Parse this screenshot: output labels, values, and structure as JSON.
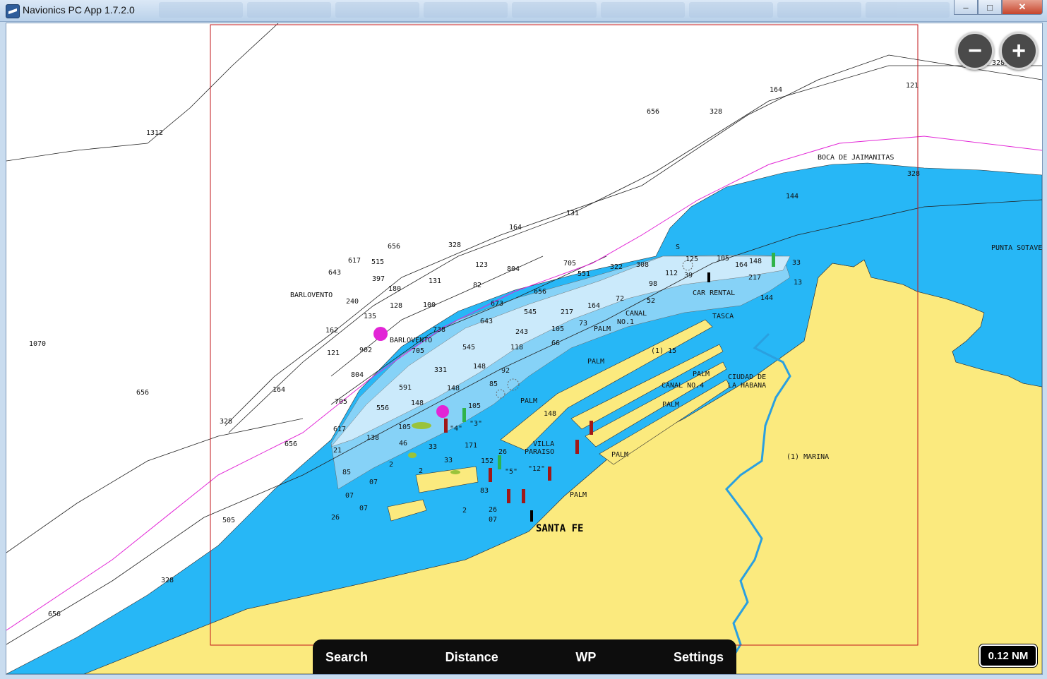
{
  "window": {
    "title": "Navionics PC App 1.7.2.0",
    "minimize": "–",
    "maximize": "□",
    "close": "✕"
  },
  "zoom": {
    "out": "−",
    "in": "+"
  },
  "toolbar": {
    "search": "Search",
    "distance": "Distance",
    "wp": "WP",
    "settings": "Settings"
  },
  "scale_label": "0.12 NM",
  "places": {
    "barlovento1": "BARLOVENTO",
    "barlovento2": "BARLOVENTO",
    "boca": "BOCA DE JAIMANITAS",
    "punta": "PUNTA SOTAVE",
    "car_rental": "CAR RENTAL",
    "tasca": "TASCA",
    "canal1a": "CANAL",
    "canal1b": "NO.1",
    "canal4": "CANAL NO.4",
    "ciudad1": "CIUDAD DE",
    "ciudad2": "LA HABANA",
    "villa1": "VILLA",
    "villa2": "PARAISO",
    "marina": "(1) MARINA",
    "santa_fe": "SANTA FE",
    "palm1": "PALM",
    "palm2": "PALM",
    "palm3": "PALM",
    "palm4": "PALM",
    "palm5": "PALM",
    "palm6": "PALM",
    "palm7": "PALM",
    "s": "S",
    "paren1": "(1) 15",
    "q4": "\"4\"",
    "q3": "\"3\"",
    "q5": "\"5\"",
    "q12": "\"12\""
  },
  "depths": {
    "d1312": "1312",
    "d1070": "1070",
    "d656a": "656",
    "d328a": "328",
    "d505": "505",
    "d328b": "328",
    "d656b": "656",
    "d617": "617",
    "d656c": "656",
    "d328c": "328",
    "d643": "643",
    "d515": "515",
    "d397": "397",
    "d180": "180",
    "d240": "240",
    "d128": "128",
    "d135": "135",
    "d162": "162",
    "d902": "902",
    "d121": "121",
    "d804a": "804",
    "d164a": "164",
    "d705a": "705",
    "d617b": "617",
    "d656d": "656",
    "d21": "21",
    "d131a": "131",
    "d100": "100",
    "d123": "123",
    "d82": "82",
    "d738": "738",
    "d705b": "705",
    "d591": "591",
    "d556": "556",
    "d643b": "643",
    "d673": "673",
    "d545": "545",
    "d243": "243",
    "d118": "118",
    "d148a": "148",
    "d331": "331",
    "d92": "92",
    "d85": "85",
    "d148b": "148",
    "d148c": "148",
    "d105a": "105",
    "d138": "138",
    "d46": "46",
    "d33a": "33",
    "d2a": "2",
    "d2b": "2",
    "d33b": "33",
    "d07a": "07",
    "d07b": "07",
    "d07c": "07",
    "d26a": "26",
    "d26b": "26",
    "d2c": "2",
    "d07d": "07",
    "d83": "83",
    "d26c": "26",
    "d171": "171",
    "d152": "152",
    "d85b": "85",
    "d656e": "656",
    "d328d": "328",
    "d164b": "164",
    "d121b": "121",
    "d328e": "328",
    "d328f": "328",
    "d131b": "131",
    "d164c": "164",
    "d804b": "804",
    "d551": "551",
    "d705c": "705",
    "d656f": "656",
    "d217": "217",
    "d105b": "105",
    "d73": "73",
    "d66": "66",
    "d164d": "164",
    "d72": "72",
    "d52": "52",
    "d98": "98",
    "d322": "322",
    "d308": "308",
    "d112": "112",
    "d125": "125",
    "d39": "39",
    "d105c": "105",
    "d164e": "164",
    "d148d": "148",
    "d33c": "33",
    "d217b": "217",
    "d13": "13",
    "d144": "144",
    "d144b": "144",
    "d148e": "148",
    "d105d": "105"
  },
  "colors": {
    "land": "#fbea7e",
    "deep_water": "#ffffff",
    "shallow_water": "#27b7f6",
    "medium_water": "#86d2f7",
    "light_water": "#cbeafb",
    "track_line": "#e225d6",
    "boundary": "#c0141a"
  }
}
